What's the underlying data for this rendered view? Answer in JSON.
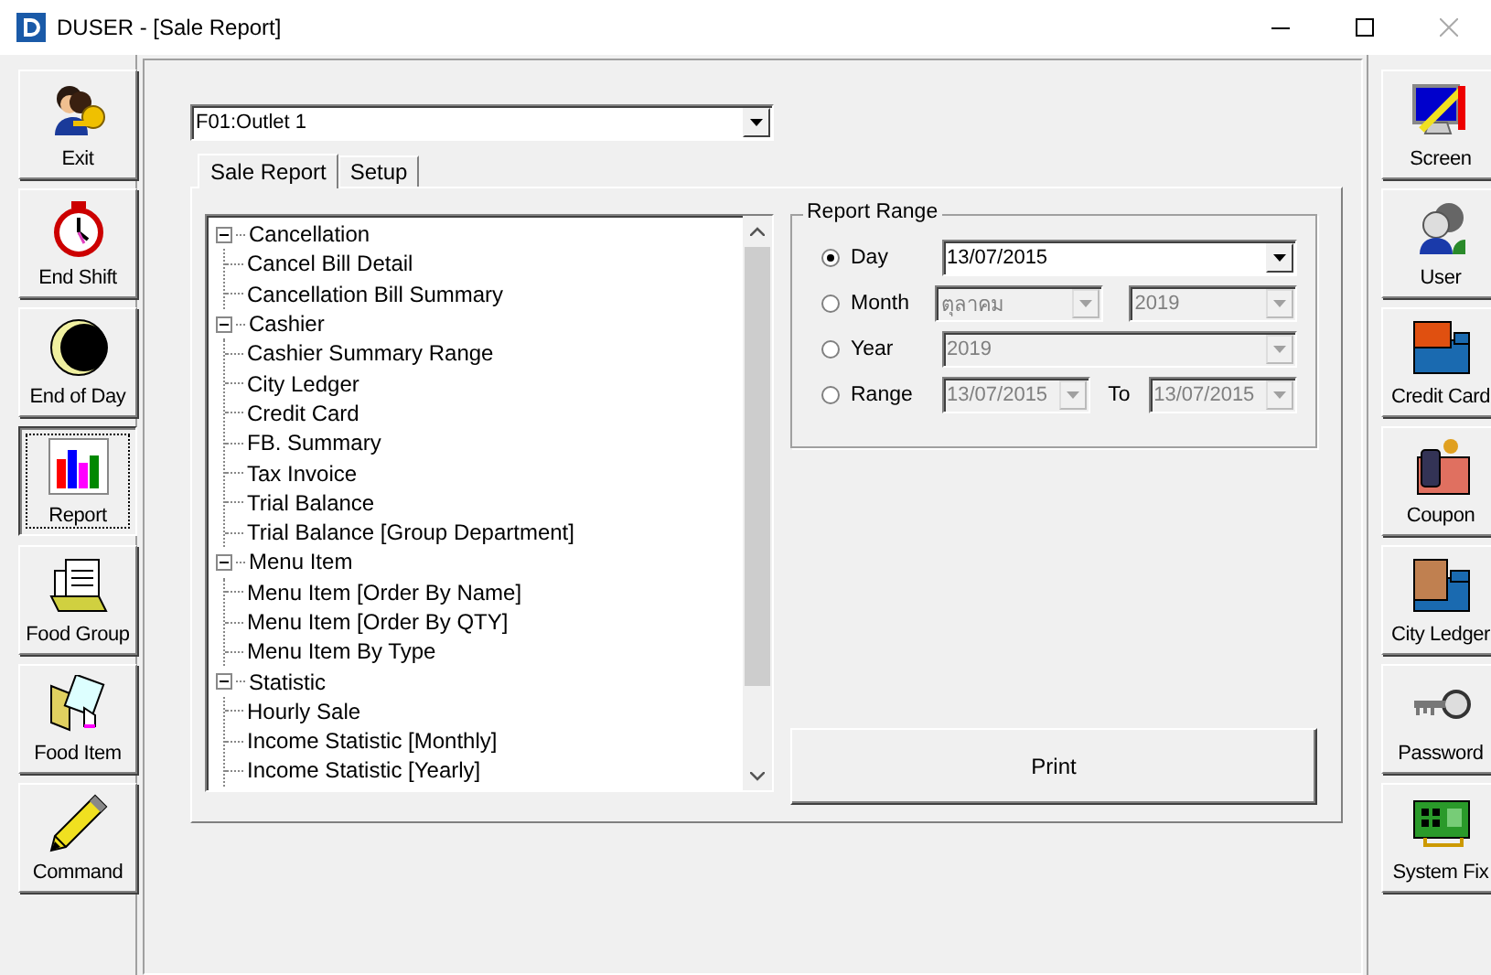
{
  "window": {
    "title": "DUSER - [Sale Report]"
  },
  "left_toolbar": [
    {
      "label": "Exit",
      "selected": false
    },
    {
      "label": "End Shift",
      "selected": false
    },
    {
      "label": "End of Day",
      "selected": false
    },
    {
      "label": "Report",
      "selected": true
    },
    {
      "label": "Food Group",
      "selected": false
    },
    {
      "label": "Food Item",
      "selected": false
    },
    {
      "label": "Command",
      "selected": false
    }
  ],
  "outlet": {
    "value": "F01:Outlet 1"
  },
  "tabs": [
    {
      "label": "Sale Report",
      "selected": true
    },
    {
      "label": "Setup",
      "selected": false
    }
  ],
  "tree": [
    {
      "label": "Cancellation",
      "expanded": true,
      "children": [
        {
          "label": "Cancel Bill Detail"
        },
        {
          "label": "Cancellation Bill Summary"
        }
      ]
    },
    {
      "label": "Cashier",
      "expanded": true,
      "children": [
        {
          "label": "Cashier Summary Range"
        },
        {
          "label": "City Ledger"
        },
        {
          "label": "Credit Card"
        },
        {
          "label": "FB. Summary"
        },
        {
          "label": "Tax Invoice"
        },
        {
          "label": "Trial Balance"
        },
        {
          "label": "Trial Balance [Group Department]"
        }
      ]
    },
    {
      "label": "Menu Item",
      "expanded": true,
      "children": [
        {
          "label": "Menu Item [Order By Name]"
        },
        {
          "label": "Menu Item [Order By QTY]"
        },
        {
          "label": "Menu Item By Type"
        }
      ]
    },
    {
      "label": "Statistic",
      "expanded": true,
      "children": [
        {
          "label": "Hourly Sale"
        },
        {
          "label": "Income Statistic [Monthly]"
        },
        {
          "label": "Income Statistic [Yearly]"
        }
      ]
    }
  ],
  "report_range": {
    "title": "Report Range",
    "options": [
      {
        "label": "Day",
        "selected": true,
        "fields": [
          {
            "value": "13/07/2015",
            "disabled": false
          }
        ]
      },
      {
        "label": "Month",
        "selected": false,
        "fields": [
          {
            "value": "ตุลาคม",
            "disabled": true
          },
          {
            "value": "2019",
            "disabled": true
          }
        ]
      },
      {
        "label": "Year",
        "selected": false,
        "fields": [
          {
            "value": "2019",
            "disabled": true
          }
        ]
      },
      {
        "label": "Range",
        "selected": false,
        "fields": [
          {
            "value": "13/07/2015",
            "disabled": true
          },
          {
            "value": "13/07/2015",
            "disabled": true
          }
        ],
        "separator": "To"
      }
    ]
  },
  "print_button": {
    "label": "Print"
  },
  "right_toolbar": [
    {
      "label": "Screen"
    },
    {
      "label": "User"
    },
    {
      "label": "Credit Card"
    },
    {
      "label": "Coupon"
    },
    {
      "label": "City Ledger"
    },
    {
      "label": "Password"
    },
    {
      "label": "System Fix"
    }
  ]
}
